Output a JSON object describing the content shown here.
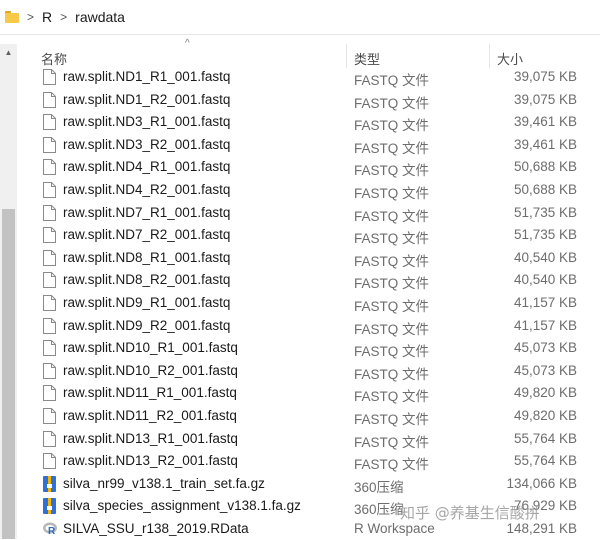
{
  "breadcrumb": [
    "R",
    "rawdata"
  ],
  "columns": {
    "name": "名称",
    "type": "类型",
    "size": "大小"
  },
  "files": [
    {
      "name": "raw.split.ND1_R1_001.fastq",
      "type": "FASTQ 文件",
      "size": "39,075 KB",
      "icon": "blank-file-icon"
    },
    {
      "name": "raw.split.ND1_R2_001.fastq",
      "type": "FASTQ 文件",
      "size": "39,075 KB",
      "icon": "blank-file-icon"
    },
    {
      "name": "raw.split.ND3_R1_001.fastq",
      "type": "FASTQ 文件",
      "size": "39,461 KB",
      "icon": "blank-file-icon"
    },
    {
      "name": "raw.split.ND3_R2_001.fastq",
      "type": "FASTQ 文件",
      "size": "39,461 KB",
      "icon": "blank-file-icon"
    },
    {
      "name": "raw.split.ND4_R1_001.fastq",
      "type": "FASTQ 文件",
      "size": "50,688 KB",
      "icon": "blank-file-icon"
    },
    {
      "name": "raw.split.ND4_R2_001.fastq",
      "type": "FASTQ 文件",
      "size": "50,688 KB",
      "icon": "blank-file-icon"
    },
    {
      "name": "raw.split.ND7_R1_001.fastq",
      "type": "FASTQ 文件",
      "size": "51,735 KB",
      "icon": "blank-file-icon"
    },
    {
      "name": "raw.split.ND7_R2_001.fastq",
      "type": "FASTQ 文件",
      "size": "51,735 KB",
      "icon": "blank-file-icon"
    },
    {
      "name": "raw.split.ND8_R1_001.fastq",
      "type": "FASTQ 文件",
      "size": "40,540 KB",
      "icon": "blank-file-icon"
    },
    {
      "name": "raw.split.ND8_R2_001.fastq",
      "type": "FASTQ 文件",
      "size": "40,540 KB",
      "icon": "blank-file-icon"
    },
    {
      "name": "raw.split.ND9_R1_001.fastq",
      "type": "FASTQ 文件",
      "size": "41,157 KB",
      "icon": "blank-file-icon"
    },
    {
      "name": "raw.split.ND9_R2_001.fastq",
      "type": "FASTQ 文件",
      "size": "41,157 KB",
      "icon": "blank-file-icon"
    },
    {
      "name": "raw.split.ND10_R1_001.fastq",
      "type": "FASTQ 文件",
      "size": "45,073 KB",
      "icon": "blank-file-icon"
    },
    {
      "name": "raw.split.ND10_R2_001.fastq",
      "type": "FASTQ 文件",
      "size": "45,073 KB",
      "icon": "blank-file-icon"
    },
    {
      "name": "raw.split.ND11_R1_001.fastq",
      "type": "FASTQ 文件",
      "size": "49,820 KB",
      "icon": "blank-file-icon"
    },
    {
      "name": "raw.split.ND11_R2_001.fastq",
      "type": "FASTQ 文件",
      "size": "49,820 KB",
      "icon": "blank-file-icon"
    },
    {
      "name": "raw.split.ND13_R1_001.fastq",
      "type": "FASTQ 文件",
      "size": "55,764 KB",
      "icon": "blank-file-icon"
    },
    {
      "name": "raw.split.ND13_R2_001.fastq",
      "type": "FASTQ 文件",
      "size": "55,764 KB",
      "icon": "blank-file-icon"
    },
    {
      "name": "silva_nr99_v138.1_train_set.fa.gz",
      "type": "360压缩",
      "size": "134,066 KB",
      "icon": "archive-icon"
    },
    {
      "name": "silva_species_assignment_v138.1.fa.gz",
      "type": "360压缩",
      "size": "76,929 KB",
      "icon": "archive-icon"
    },
    {
      "name": "SILVA_SSU_r138_2019.RData",
      "type": "R Workspace",
      "size": "148,291 KB",
      "icon": "r-workspace-icon"
    }
  ],
  "watermark": "知乎 @养基生信酸拼",
  "colors": {
    "folder": "#f7c948",
    "archive_blue": "#2f6fd6",
    "archive_gold": "#f2b705",
    "r_blue": "#276dc3"
  }
}
